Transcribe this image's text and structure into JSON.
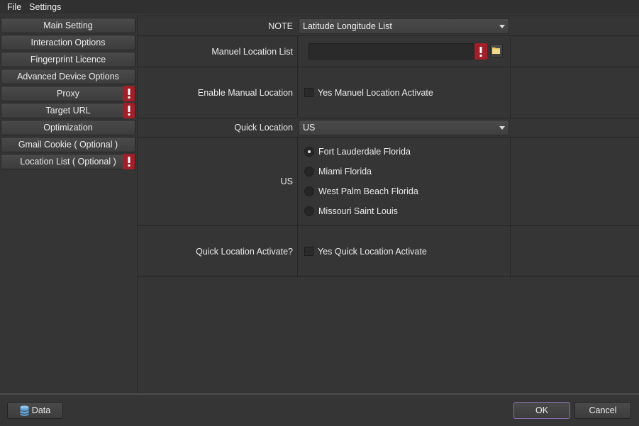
{
  "menu": {
    "file": "File",
    "settings": "Settings"
  },
  "sidebar": {
    "items": [
      {
        "label": "Main Setting",
        "warning": false
      },
      {
        "label": "Interaction Options",
        "warning": false
      },
      {
        "label": "Fingerprint Licence",
        "warning": false
      },
      {
        "label": "Advanced Device Options",
        "warning": false
      },
      {
        "label": "Proxy",
        "warning": true
      },
      {
        "label": "Target URL",
        "warning": true
      },
      {
        "label": "Optimization",
        "warning": false
      },
      {
        "label": "Gmail Cookie ( Optional )",
        "warning": false
      },
      {
        "label": "Location List ( Optional )",
        "warning": true
      }
    ]
  },
  "form": {
    "note_label": "NOTE",
    "note_value": "Latitude Longitude List",
    "manual_list_label": "Manuel Location List",
    "manual_list_value": "",
    "enable_manual_label": "Enable Manual Location",
    "enable_manual_checkbox": "Yes Manuel Location Activate",
    "enable_manual_checked": false,
    "quick_location_label": "Quick Location",
    "quick_location_value": "US",
    "us_label": "US",
    "us_options": [
      {
        "label": "Fort Lauderdale Florida",
        "checked": true
      },
      {
        "label": "Miami Florida",
        "checked": false
      },
      {
        "label": "West Palm Beach Florida",
        "checked": false
      },
      {
        "label": "Missouri Saint Louis",
        "checked": false
      }
    ],
    "quick_activate_label": "Quick Location Activate?",
    "quick_activate_checkbox": "Yes Quick Location Activate",
    "quick_activate_checked": false
  },
  "footer": {
    "data_label": "Data",
    "ok_label": "OK",
    "cancel_label": "Cancel"
  },
  "colors": {
    "warning": "#a01f28",
    "ok_border": "#8b6fb0",
    "background": "#353535"
  }
}
